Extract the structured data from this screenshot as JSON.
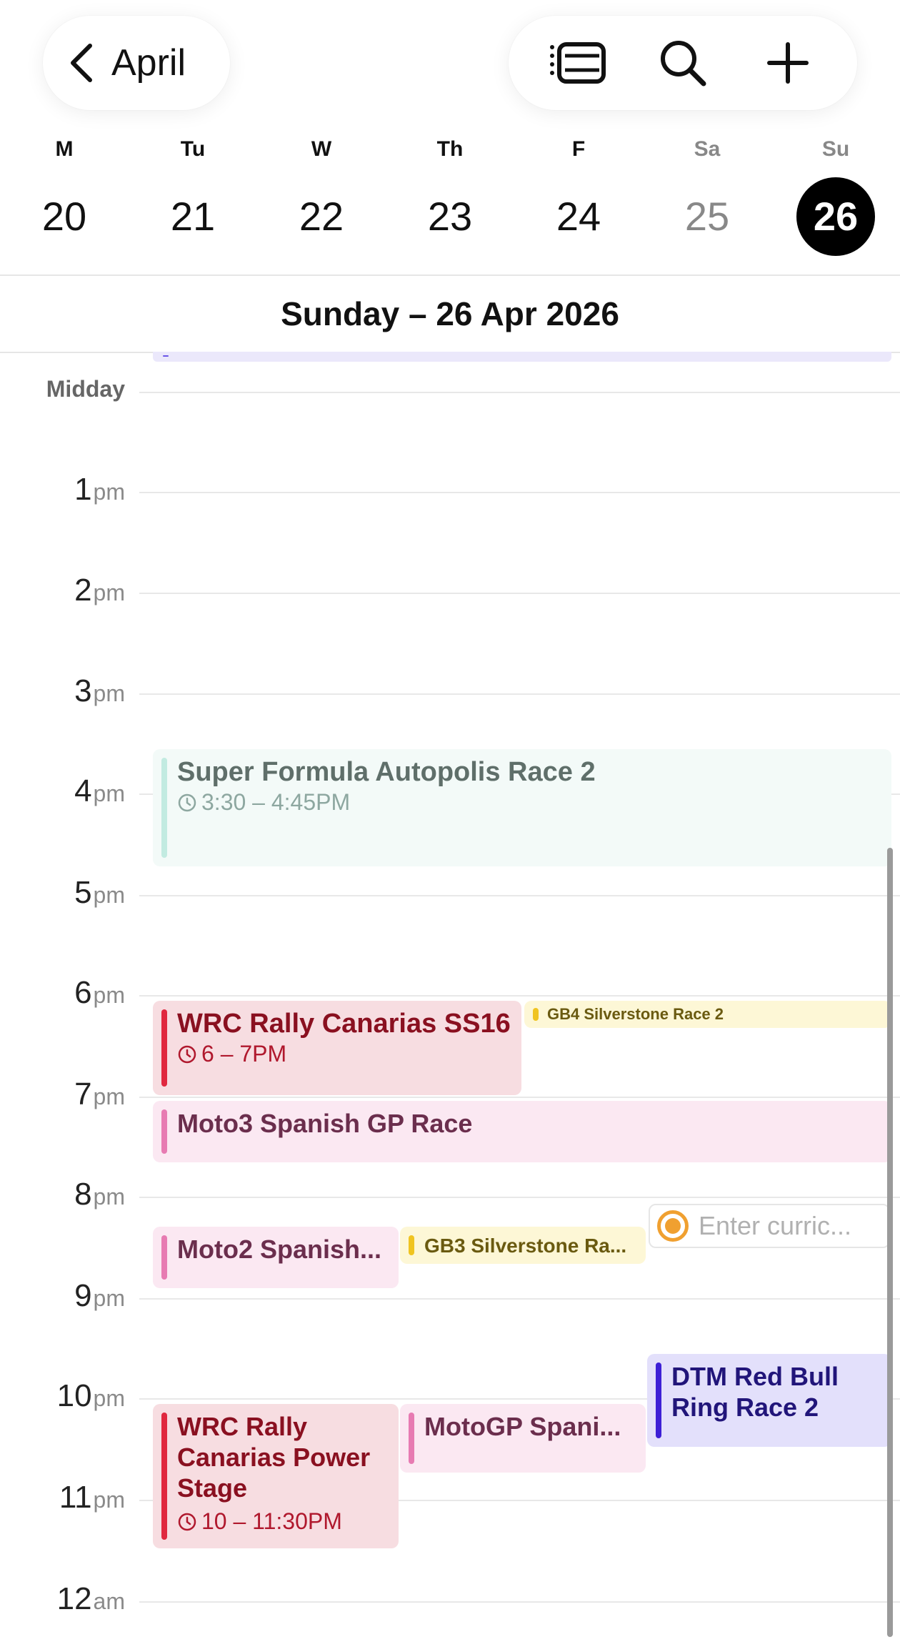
{
  "header": {
    "back_label": "April",
    "tools": [
      {
        "name": "list-view-icon"
      },
      {
        "name": "search-icon"
      },
      {
        "name": "add-icon"
      }
    ]
  },
  "week": [
    {
      "dow": "M",
      "day": "20"
    },
    {
      "dow": "Tu",
      "day": "21"
    },
    {
      "dow": "W",
      "day": "22"
    },
    {
      "dow": "Th",
      "day": "23"
    },
    {
      "dow": "F",
      "day": "24"
    },
    {
      "dow": "Sa",
      "day": "25",
      "weekend": true
    },
    {
      "dow": "Su",
      "day": "26",
      "today": true
    }
  ],
  "date_title": "Sunday – 26 Apr 2026",
  "hours": [
    {
      "num": "Midday",
      "suf": ""
    },
    {
      "num": "1",
      "suf": "pm"
    },
    {
      "num": "2",
      "suf": "pm"
    },
    {
      "num": "3",
      "suf": "pm"
    },
    {
      "num": "4",
      "suf": "pm"
    },
    {
      "num": "5",
      "suf": "pm"
    },
    {
      "num": "6",
      "suf": "pm"
    },
    {
      "num": "7",
      "suf": "pm"
    },
    {
      "num": "8",
      "suf": "pm"
    },
    {
      "num": "9",
      "suf": "pm"
    },
    {
      "num": "10",
      "suf": "pm"
    },
    {
      "num": "11",
      "suf": "pm"
    },
    {
      "num": "12",
      "suf": "am"
    }
  ],
  "events": {
    "super_formula": {
      "title": "Super Formula Autopolis Race 2",
      "time": "3:30 – 4:45PM"
    },
    "wrc_ss16": {
      "title": "WRC Rally Canarias SS16",
      "time": "6 – 7PM"
    },
    "gb4": {
      "title": "GB4 Silverstone Race 2"
    },
    "moto3": {
      "title": "Moto3 Spanish GP Race"
    },
    "moto2": {
      "title": "Moto2 Spanish..."
    },
    "gb3": {
      "title": "GB3 Silverstone Ra..."
    },
    "dtm": {
      "title": "DTM Red Bull Ring Race 2"
    },
    "wrc_power": {
      "title": "WRC Rally Canarias Power Stage",
      "time": "10 – 11:30PM"
    },
    "motogp": {
      "title": "MotoGP Spani..."
    }
  },
  "new_event": {
    "placeholder": "Enter curric..."
  },
  "colors": {
    "today_bg": "#000000",
    "wrc": "#e0283f",
    "moto": "#e77bb2",
    "gb": "#f0c420",
    "dtm": "#3d1fd6",
    "super_formula": "#c2ebe1",
    "new_event_dot": "#f0a030"
  }
}
